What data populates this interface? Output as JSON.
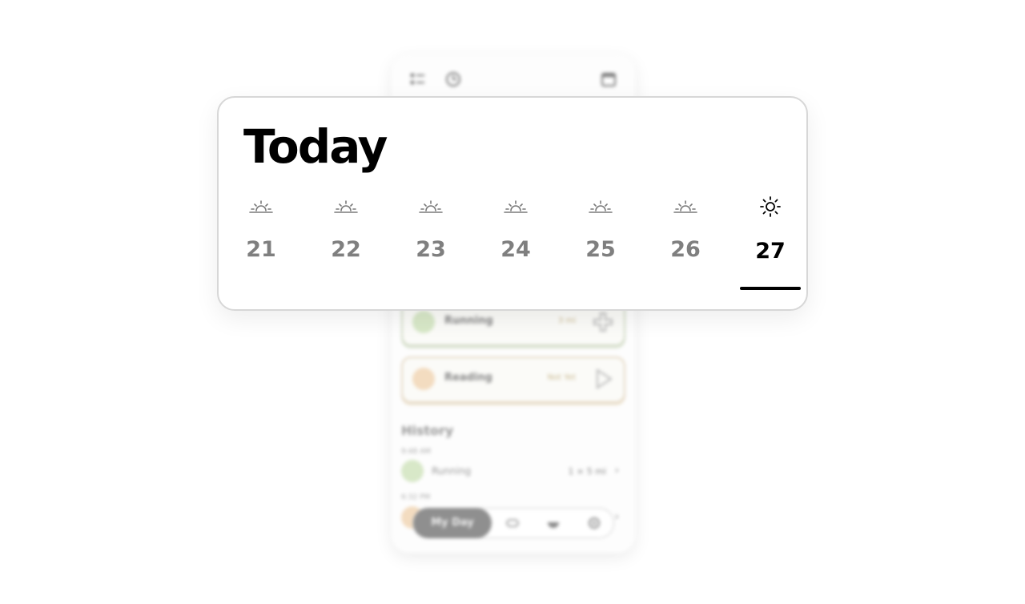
{
  "header": {
    "title": "Today",
    "icons": [
      "list-icon",
      "clock-icon",
      "calendar-icon"
    ]
  },
  "days": [
    {
      "date": "21",
      "icon": "sunrise-icon",
      "selected": false
    },
    {
      "date": "22",
      "icon": "sunrise-icon",
      "selected": false
    },
    {
      "date": "23",
      "icon": "sunrise-icon",
      "selected": false
    },
    {
      "date": "24",
      "icon": "sunrise-icon",
      "selected": false
    },
    {
      "date": "25",
      "icon": "sunrise-icon",
      "selected": false
    },
    {
      "date": "26",
      "icon": "sunrise-icon",
      "selected": false
    },
    {
      "date": "27",
      "icon": "sun-icon",
      "selected": true
    }
  ],
  "habits": [
    {
      "name": "Running",
      "progress": "3 mi",
      "action_icon": "plus-icon",
      "color": "#d8e8c8"
    },
    {
      "name": "Reading",
      "progress": "Not Yet",
      "action_icon": "play-icon",
      "color": "#f3dcc0"
    }
  ],
  "history": {
    "title": "History",
    "entries": [
      {
        "time": "9:48 AM",
        "name": "Running",
        "value": "1 × 5 mi",
        "color": "#d8e8c8"
      },
      {
        "time": "6:32 PM",
        "name": "",
        "value": "",
        "color": "#f3dcc0"
      }
    ]
  },
  "tabbar": {
    "active_label": "My Day",
    "icons": [
      "my-day-icon",
      "toggle-icon",
      "bowl-icon",
      "settings-icon"
    ]
  },
  "colors": {
    "accent": "#000000",
    "muted_text": "#7f7f7f",
    "card_border": "#d7d7d7"
  }
}
